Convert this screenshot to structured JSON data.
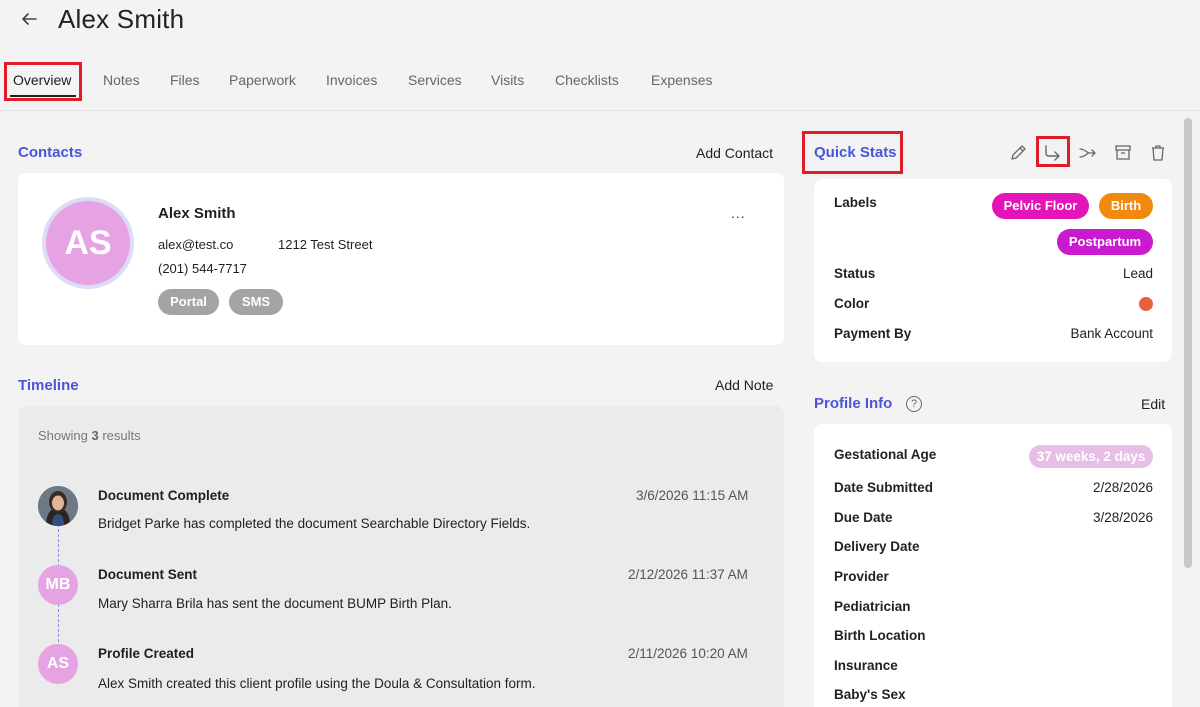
{
  "header": {
    "title": "Alex Smith"
  },
  "tabs": [
    {
      "label": "Overview"
    },
    {
      "label": "Notes"
    },
    {
      "label": "Files"
    },
    {
      "label": "Paperwork"
    },
    {
      "label": "Invoices"
    },
    {
      "label": "Services"
    },
    {
      "label": "Visits"
    },
    {
      "label": "Checklists"
    },
    {
      "label": "Expenses"
    }
  ],
  "contacts": {
    "title": "Contacts",
    "add_label": "Add Contact",
    "more_label": "...",
    "contact": {
      "initials": "AS",
      "name": "Alex Smith",
      "email": "alex@test.co",
      "address": "1212 Test Street",
      "phone": "(201) 544-7717",
      "pills": [
        "Portal",
        "SMS"
      ]
    }
  },
  "timeline": {
    "title": "Timeline",
    "add_label": "Add Note",
    "showing_prefix": "Showing ",
    "showing_count": "3",
    "showing_suffix": " results",
    "items": [
      {
        "title": "Document Complete",
        "desc": "Bridget Parke has completed the document Searchable Directory Fields.",
        "time": "3/6/2026 11:15 AM",
        "initials": ""
      },
      {
        "title": "Document Sent",
        "desc": "Mary Sharra Brila has sent the document BUMP Birth Plan.",
        "time": "2/12/2026 11:37 AM",
        "initials": "MB"
      },
      {
        "title": "Profile Created",
        "desc": "Alex Smith created this client profile using the Doula & Consultation form.",
        "time": "2/11/2026 10:20 AM",
        "initials": "AS"
      }
    ]
  },
  "quick_stats": {
    "title": "Quick Stats",
    "labels_label": "Labels",
    "tags": [
      {
        "text": "Pelvic Floor",
        "color": "#e314b8"
      },
      {
        "text": "Birth",
        "color": "#ef8a0e"
      },
      {
        "text": "Postpartum",
        "color": "#c91ad0"
      }
    ],
    "rows": [
      {
        "label": "Status",
        "value": "Lead"
      },
      {
        "label": "Color",
        "value": ""
      },
      {
        "label": "Payment By",
        "value": "Bank Account"
      }
    ],
    "color_value": "#e8603c"
  },
  "profile_info": {
    "title": "Profile Info",
    "edit_label": "Edit",
    "help_glyph": "?",
    "rows": [
      {
        "label": "Gestational Age",
        "value": "37 weeks, 2 days"
      },
      {
        "label": "Date Submitted",
        "value": "2/28/2026"
      },
      {
        "label": "Due Date",
        "value": "3/28/2026"
      },
      {
        "label": "Delivery Date",
        "value": ""
      },
      {
        "label": "Provider",
        "value": ""
      },
      {
        "label": "Pediatrician",
        "value": ""
      },
      {
        "label": "Birth Location",
        "value": ""
      },
      {
        "label": "Insurance",
        "value": ""
      },
      {
        "label": "Baby's Sex",
        "value": ""
      }
    ]
  },
  "icons": [
    "back-arrow-icon",
    "pencil-icon",
    "share-icon",
    "shuffle-icon",
    "archive-icon",
    "trash-icon"
  ],
  "colors": {
    "accent": "#4a55d8",
    "highlight": "#e01e2a",
    "avatar": "#e6a3e3"
  }
}
